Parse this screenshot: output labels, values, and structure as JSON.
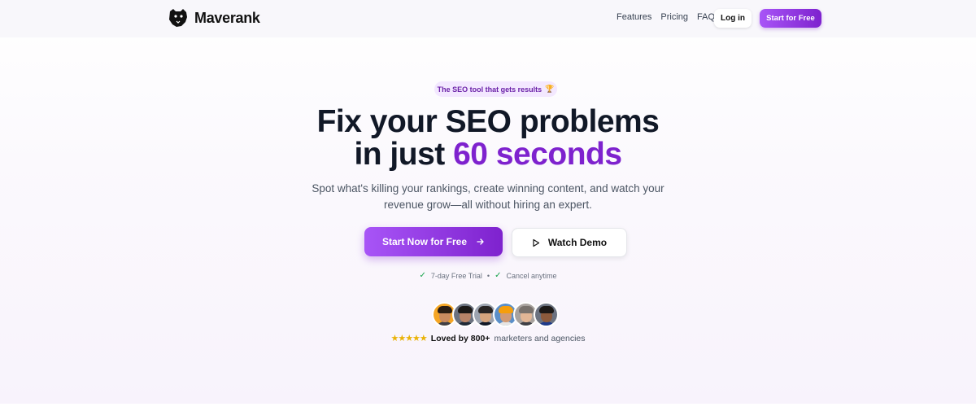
{
  "brand": {
    "name": "Maverank"
  },
  "nav": {
    "links": [
      "Features",
      "Pricing",
      "FAQ"
    ],
    "login_label": "Log in",
    "cta_label": "Start for Free"
  },
  "hero": {
    "pill_text": "The SEO tool that gets results",
    "pill_emoji": "🏆",
    "headline_line1": "Fix your SEO problems",
    "headline_line2_prefix": "in just ",
    "headline_accent": "60 seconds",
    "subtext": "Spot what's killing your rankings, create winning content, and watch your revenue grow—all without hiring an expert.",
    "primary_cta": "Start Now for Free",
    "secondary_cta": "Watch Demo",
    "perk_1": "7-day Free Trial",
    "perk_separator": "•",
    "perk_2": "Cancel anytime",
    "stars": "★★★★★",
    "social_bold": "Loved by 800+",
    "social_rest": "marketers and agencies"
  },
  "colors": {
    "accent": "#7e22ce",
    "accent_light": "#a855f7",
    "pill_bg": "#f3e8ff",
    "check": "#16a34a",
    "star": "#eab308"
  },
  "icons": {
    "logo": "panther-head-icon",
    "arrow": "arrow-right-icon",
    "play": "play-icon",
    "check": "check-icon"
  }
}
